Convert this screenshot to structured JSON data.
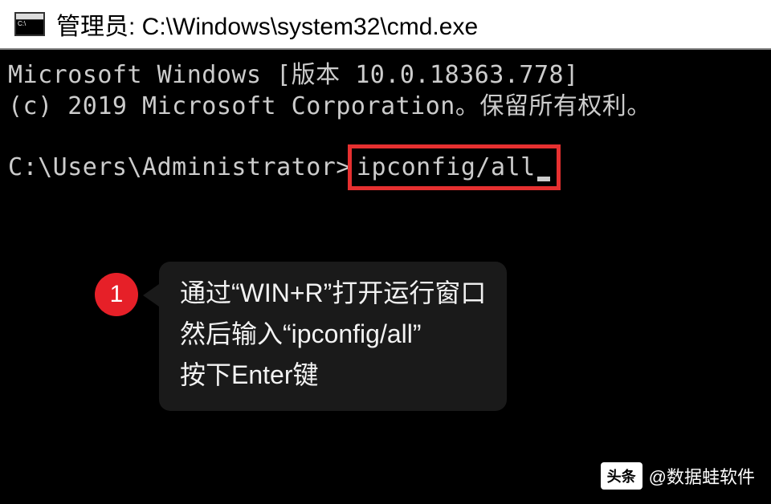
{
  "window": {
    "title": "管理员: C:\\Windows\\system32\\cmd.exe"
  },
  "terminal": {
    "line1": "Microsoft Windows [版本 10.0.18363.778]",
    "line2": "(c) 2019 Microsoft Corporation。保留所有权利。",
    "prompt": "C:\\Users\\Administrator>",
    "command": "ipconfig/all"
  },
  "callout": {
    "number": "1",
    "line1": "通过“WIN+R”打开运行窗口",
    "line2": "然后输入“ipconfig/all”",
    "line3": "按下Enter键"
  },
  "watermark": {
    "icon_text": "头条",
    "author": "@数据蛙软件"
  }
}
